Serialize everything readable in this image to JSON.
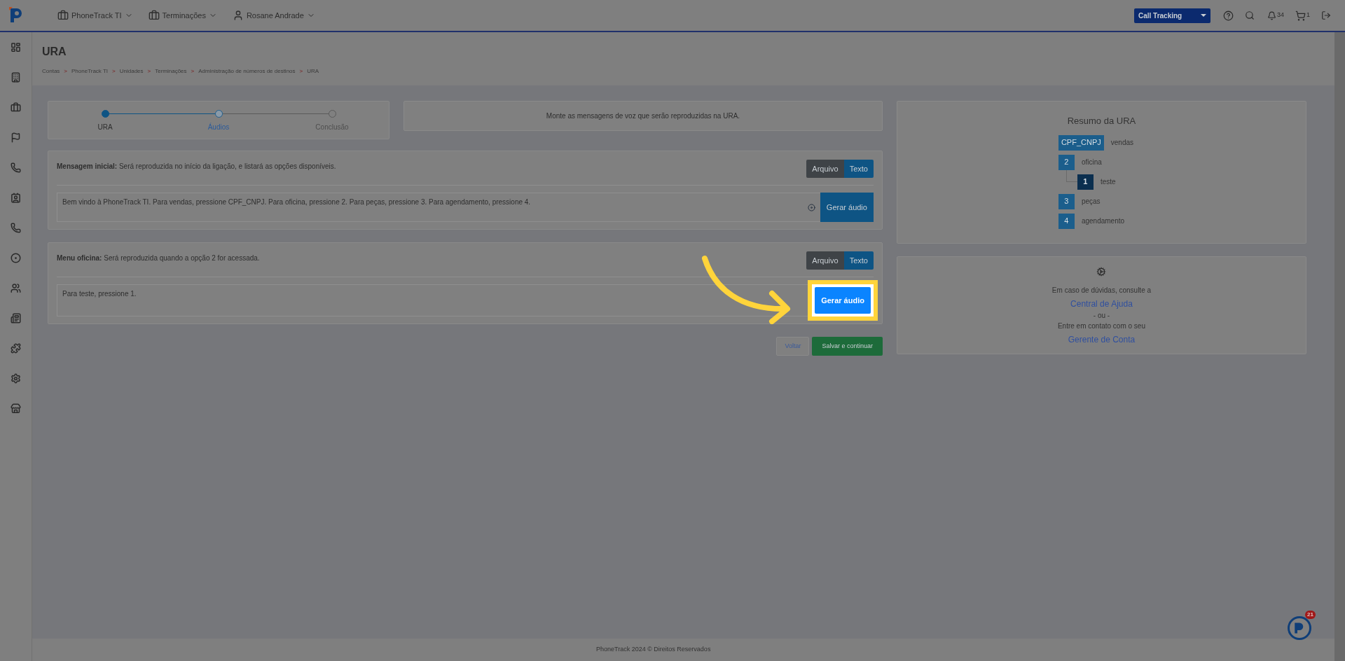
{
  "topbar": {
    "nav": [
      {
        "label": "PhoneTrack TI",
        "kind": "briefcase"
      },
      {
        "label": "Terminações",
        "kind": "briefcase"
      },
      {
        "label": "Rosane Andrade",
        "kind": "user"
      }
    ],
    "product_select": "Call Tracking",
    "notifications": "34",
    "cart": "1"
  },
  "page": {
    "title": "URA",
    "separator": ">",
    "breadcrumb": [
      "Contas",
      "PhoneTrack TI",
      "Unidades",
      "Terminações",
      "Administração de números de destinos",
      "URA"
    ]
  },
  "stepper": [
    {
      "label": "URA",
      "kind": "done"
    },
    {
      "label": "Áudios",
      "kind": "current"
    },
    {
      "label": "Conclusão",
      "kind": "pending"
    }
  ],
  "info": "Monte as mensagens de voz que serão reproduzidas na URA.",
  "messages": [
    {
      "label": "Mensagem inicial:",
      "description": "Será reproduzida no início da ligação, e listará as opções disponíveis.",
      "modes": [
        {
          "label": "Arquivo",
          "selected": false
        },
        {
          "label": "Texto",
          "selected": true
        }
      ],
      "text": "Bem vindo à PhoneTrack TI. Para vendas, pressione CPF_CNPJ. Para oficina, pressione 2. Para peças, pressione 3. Para agendamento, pressione 4.",
      "button": "Gerar áudio",
      "highlighted": false
    },
    {
      "label": "Menu oficina:",
      "description": "Será reproduzida quando a opção 2 for acessada.",
      "modes": [
        {
          "label": "Arquivo",
          "selected": false
        },
        {
          "label": "Texto",
          "selected": true
        }
      ],
      "text": "Para teste, pressione 1.",
      "button": "Gerar áudio",
      "highlighted": true
    }
  ],
  "actions": {
    "back": "Voltar",
    "save": "Salvar e continuar"
  },
  "summary": {
    "title": "Resumo da URA",
    "options": [
      {
        "key": "CPF_CNPJ",
        "label": "vendas"
      },
      {
        "key": "2",
        "label": "oficina",
        "children": [
          {
            "key": "1",
            "label": "teste"
          }
        ]
      },
      {
        "key": "3",
        "label": "peças"
      },
      {
        "key": "4",
        "label": "agendamento"
      }
    ]
  },
  "help": {
    "line1": "Em caso de dúvidas, consulte a",
    "link1": "Central de Ajuda",
    "separator": "- ou -",
    "line2": "Entre em contato com o seu",
    "link2": "Gerente de Conta"
  },
  "footer": "PhoneTrack 2024 © Direitos Reservados",
  "widget_badge": "21"
}
